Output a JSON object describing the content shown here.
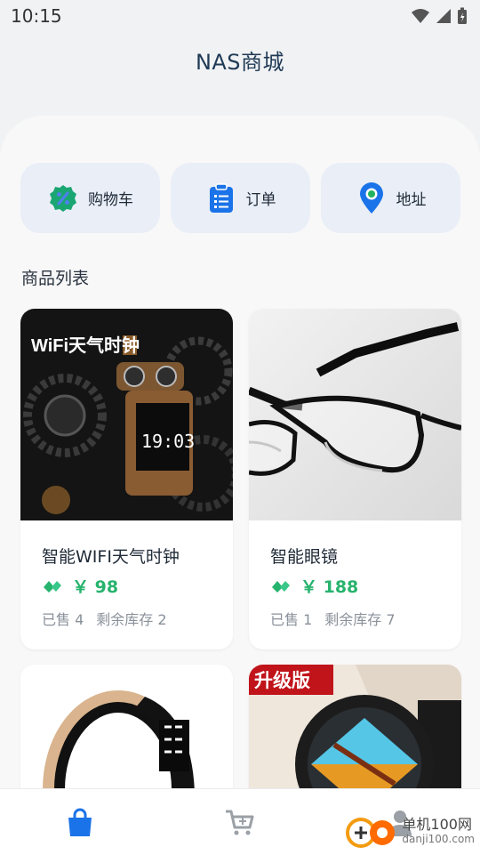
{
  "status_bar": {
    "time": "10:15"
  },
  "header": {
    "title": "NAS商城"
  },
  "quick_actions": [
    {
      "label": "购物车",
      "icon": "badge-percent-icon"
    },
    {
      "label": "订单",
      "icon": "clipboard-list-icon"
    },
    {
      "label": "地址",
      "icon": "location-pin-icon"
    }
  ],
  "product_section": {
    "title": "商品列表"
  },
  "products": [
    {
      "name": "智能WIFI天气时钟",
      "price": "￥ 98",
      "sold": "已售 4",
      "stock": "剩余库存 2",
      "image_overlay_text": "WiFi天气时钟",
      "screen_text": "19:03"
    },
    {
      "name": "智能眼镜",
      "price": "￥ 188",
      "sold": "已售 1",
      "stock": "剩余库存 7"
    },
    {
      "name": "",
      "image_overlay_text": ""
    },
    {
      "name": "",
      "image_overlay_text": "升级版"
    }
  ],
  "bottom_nav": [
    {
      "icon": "shopping-bag-icon",
      "active": true
    },
    {
      "icon": "cart-icon",
      "active": false
    },
    {
      "icon": "user-icon",
      "active": false
    }
  ],
  "watermark": {
    "text": "单机100网",
    "url": "danji100.com"
  },
  "colors": {
    "accent": "#1a73e8",
    "price": "#26b36d",
    "quick_bg": "#e9eef7"
  }
}
